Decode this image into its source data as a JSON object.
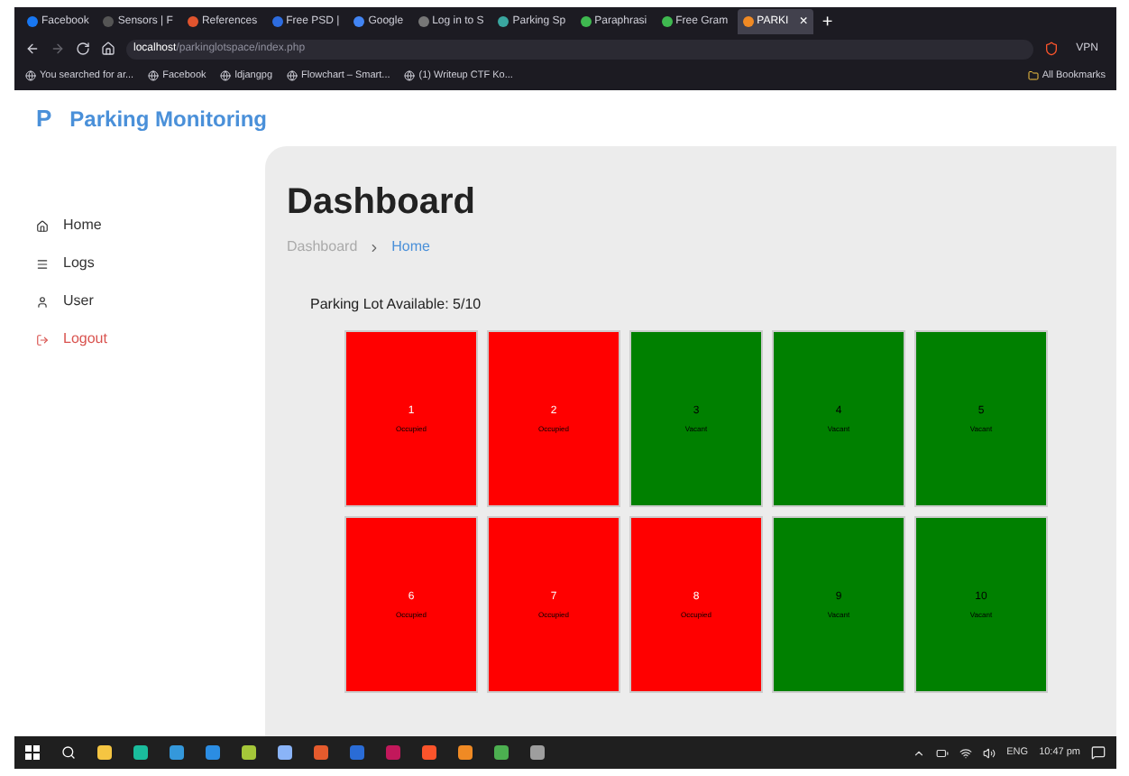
{
  "browser": {
    "tabs": [
      {
        "title": "Facebook",
        "selected": false
      },
      {
        "title": "Sensors | F",
        "selected": false
      },
      {
        "title": "References",
        "selected": false
      },
      {
        "title": "Free PSD |",
        "selected": false
      },
      {
        "title": "Google",
        "selected": false
      },
      {
        "title": "Log in to S",
        "selected": false
      },
      {
        "title": "Parking Sp",
        "selected": false
      },
      {
        "title": "Paraphrasi",
        "selected": false
      },
      {
        "title": "Free Gram",
        "selected": false
      },
      {
        "title": "PARKI",
        "selected": true
      }
    ],
    "new_tab": "+",
    "close_tab": "×",
    "address": {
      "host": "localhost",
      "path": "/parkinglotspace/index.php"
    },
    "vpn": "VPN",
    "bookmarks": [
      "You searched for ar...",
      "Facebook",
      "ldjangpg",
      "Flowchart – Smart...",
      "(1) Writeup CTF Ko..."
    ],
    "all_bookmarks": "All Bookmarks"
  },
  "app": {
    "logo_letter": "P",
    "title": "Parking Monitoring",
    "nav": [
      {
        "label": "Home",
        "kind": "home"
      },
      {
        "label": "Logs",
        "kind": "logs"
      },
      {
        "label": "User",
        "kind": "user"
      },
      {
        "label": "Logout",
        "kind": "logout"
      }
    ],
    "heading": "Dashboard",
    "breadcrumb": [
      {
        "label": "Dashboard",
        "selected": false
      },
      {
        "label": "Home",
        "selected": true
      }
    ],
    "availability": "Parking Lot Available: 5/10",
    "slots": [
      {
        "number": "1",
        "status": "Occupied",
        "occupied": true
      },
      {
        "number": "2",
        "status": "Occupied",
        "occupied": true
      },
      {
        "number": "3",
        "status": "Vacant",
        "occupied": false
      },
      {
        "number": "4",
        "status": "Vacant",
        "occupied": false
      },
      {
        "number": "5",
        "status": "Vacant",
        "occupied": false
      },
      {
        "number": "6",
        "status": "Occupied",
        "occupied": true
      },
      {
        "number": "7",
        "status": "Occupied",
        "occupied": true
      },
      {
        "number": "8",
        "status": "Occupied",
        "occupied": true
      },
      {
        "number": "9",
        "status": "Vacant",
        "occupied": false
      },
      {
        "number": "10",
        "status": "Vacant",
        "occupied": false
      }
    ]
  },
  "taskbar": {
    "language": "ENG",
    "time": "10:47 pm"
  }
}
